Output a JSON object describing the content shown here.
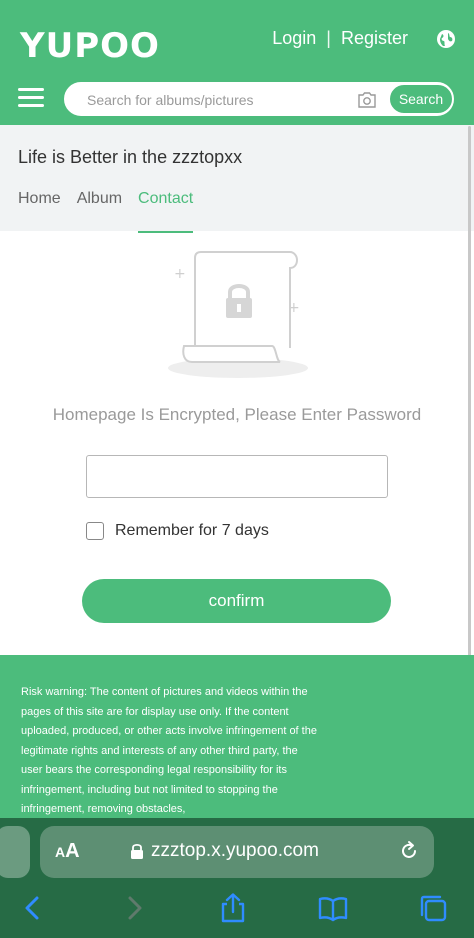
{
  "header": {
    "logo": "YUPOO",
    "login_label": "Login",
    "separator": "|",
    "register_label": "Register",
    "search_placeholder": "Search for albums/pictures",
    "search_button": "Search"
  },
  "site": {
    "title": "Life is Better in the zzztopxx",
    "tabs": [
      {
        "label": "Home",
        "active": false
      },
      {
        "label": "Album",
        "active": false
      },
      {
        "label": "Contact",
        "active": true
      }
    ]
  },
  "password_page": {
    "message": "Homepage Is Encrypted, Please Enter Password",
    "password_value": "",
    "remember_label": "Remember for 7 days",
    "remember_checked": false,
    "confirm_label": "confirm"
  },
  "footer": {
    "risk_warning": "Risk warning: The content of pictures and videos within the pages of this site are for display use only. If the content uploaded, produced, or other acts involve infringement of the legitimate rights and interests of any other third party, the user bears the corresponding legal responsibility for its infringement, including but not limited to stopping the infringement, removing obstacles,"
  },
  "browser": {
    "aa_big": "A",
    "aa_small": "A",
    "url": "zzztop.x.yupoo.com"
  },
  "colors": {
    "brand_green": "#4cbc7c",
    "safari_bar": "#266b45",
    "toolbar_icon_blue": "#2f8cff"
  },
  "icons": [
    "menu-icon",
    "globe-icon",
    "camera-icon",
    "lock-illustration",
    "lock-icon",
    "reload-icon",
    "back-icon",
    "forward-icon",
    "share-icon",
    "bookmarks-icon",
    "tabs-icon"
  ]
}
